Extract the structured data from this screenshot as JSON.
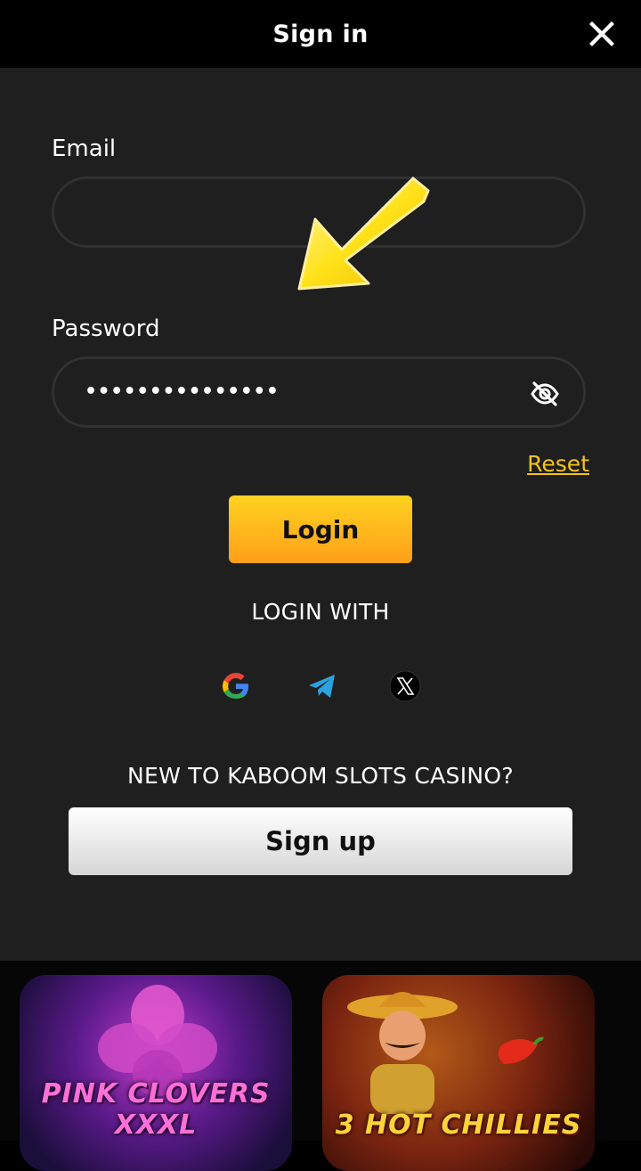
{
  "header": {
    "title": "Sign in",
    "close_icon": "close-icon"
  },
  "form": {
    "email_label": "Email",
    "email_value": "",
    "password_label": "Password",
    "password_value": "•••••••••••••••",
    "eye_icon": "eye-off-icon",
    "reset_label": "Reset",
    "login_label": "Login"
  },
  "social": {
    "heading": "LOGIN WITH",
    "providers": [
      "google-icon",
      "telegram-icon",
      "x-icon"
    ]
  },
  "signup": {
    "prompt": "NEW TO KABOOM SLOTS CASINO?",
    "button_label": "Sign up"
  },
  "games": [
    {
      "name": "PINK CLOVERS XXXL",
      "icon": "pink-clovers-thumbnail"
    },
    {
      "name": "3 HOT CHILLIES",
      "icon": "hot-chillies-thumbnail"
    }
  ],
  "colors": {
    "accent": "#f5c318",
    "panel": "#1f1f20",
    "login_gradient_top": "#ffd21f",
    "login_gradient_bottom": "#ff9f1a"
  }
}
